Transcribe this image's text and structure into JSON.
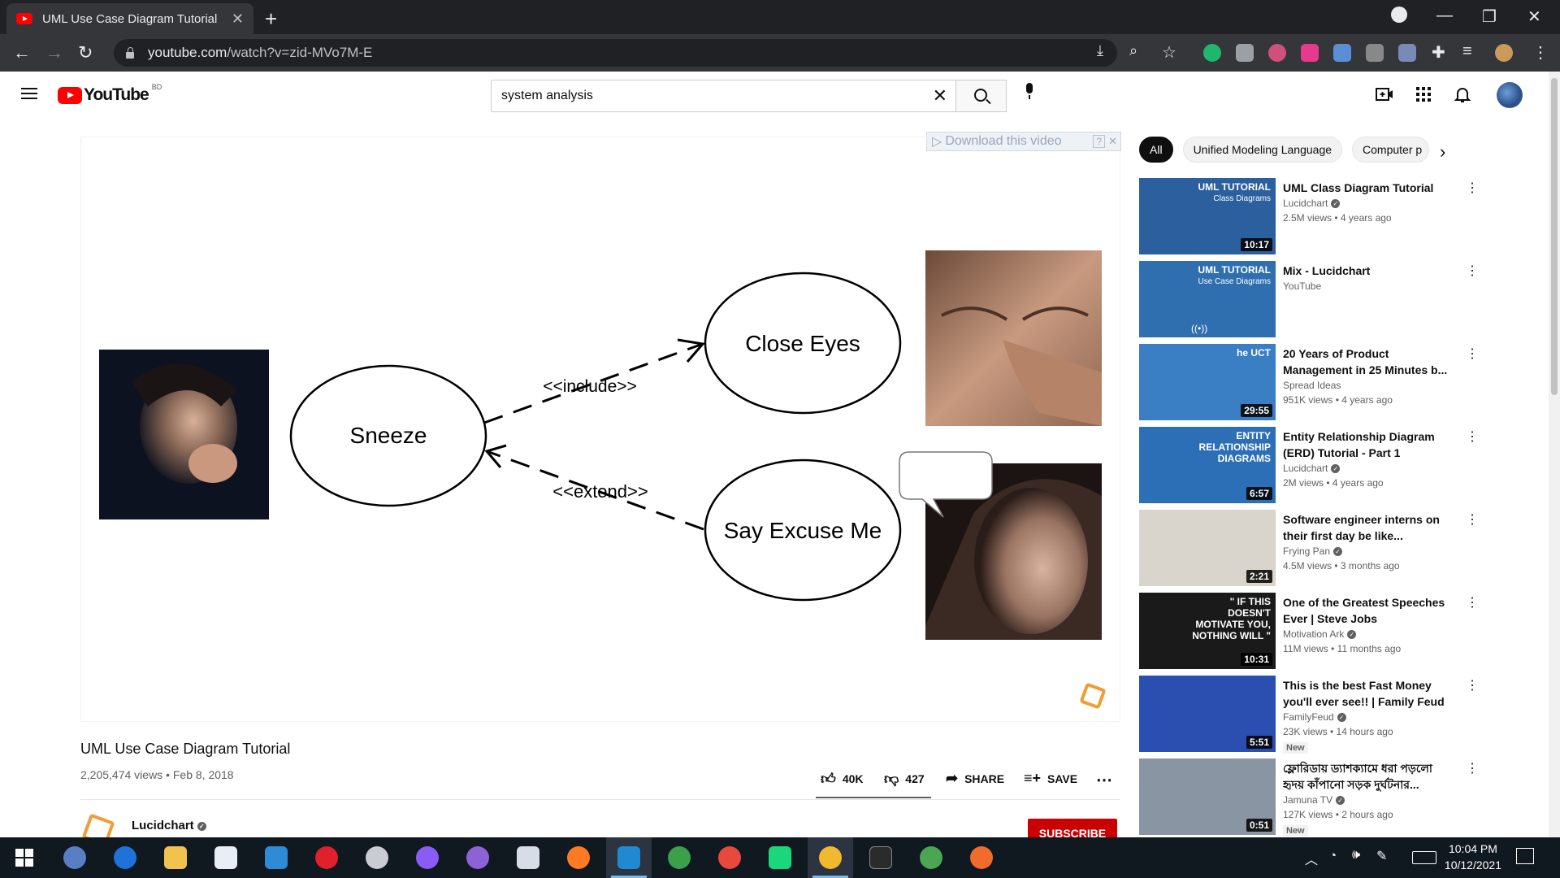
{
  "browser": {
    "tab_title": "UML Use Case Diagram Tutorial",
    "url_host": "youtube.com",
    "url_path": "/watch?v=zid-MVo7M-E"
  },
  "youtube": {
    "logo_text": "YouTube",
    "country_code": "BD",
    "search_value": "system analysis"
  },
  "video": {
    "download_bar_label": "Download this video",
    "download_bar_help": "?",
    "title": "UML Use Case Diagram Tutorial",
    "views_date": "2,205,474 views • Feb 8, 2018",
    "likes": "40K",
    "dislikes": "427",
    "share_label": "SHARE",
    "save_label": "SAVE",
    "channel": "Lucidchart",
    "subscribe_label": "SUBSCRIBE",
    "diagram": {
      "use_case_1": "Sneeze",
      "use_case_2": "Close Eyes",
      "use_case_3": "Say Excuse Me",
      "include_label": "<<include>>",
      "extend_label": "<<extend>>"
    }
  },
  "chips": [
    "All",
    "Unified Modeling Language",
    "Computer p"
  ],
  "recommendations": [
    {
      "title": "UML Class Diagram Tutorial",
      "channel": "Lucidchart",
      "verified": true,
      "meta": "2.5M views • 4 years ago",
      "duration": "10:17",
      "thumb_color": "#2b5f9e",
      "thumb_text": "UML TUTORIAL",
      "thumb_sub": "Class Diagrams"
    },
    {
      "title": "Mix - Lucidchart",
      "channel": "YouTube",
      "verified": false,
      "meta": "",
      "duration": "",
      "thumb_color": "#2f6fb0",
      "thumb_text": "UML TUTORIAL",
      "thumb_sub": "Use Case Diagrams"
    },
    {
      "title": "20 Years of Product Management in 25 Minutes b...",
      "channel": "Spread Ideas",
      "verified": false,
      "meta": "951K views • 4 years ago",
      "duration": "29:55",
      "thumb_color": "#3a7fc4",
      "thumb_text": "he UCT",
      "thumb_sub": ""
    },
    {
      "title": "Entity Relationship Diagram (ERD) Tutorial - Part 1",
      "channel": "Lucidchart",
      "verified": true,
      "meta": "2M views • 4 years ago",
      "duration": "6:57",
      "thumb_color": "#2d6fb7",
      "thumb_text": "ENTITY RELATIONSHIP DIAGRAMS",
      "thumb_sub": ""
    },
    {
      "title": "Software engineer interns on their first day be like...",
      "channel": "Frying Pan",
      "verified": true,
      "meta": "4.5M views • 3 months ago",
      "duration": "2:21",
      "thumb_color": "#d9d4cc",
      "thumb_text": "",
      "thumb_sub": ""
    },
    {
      "title": "One of the Greatest Speeches Ever | Steve Jobs",
      "channel": "Motivation Ark",
      "verified": true,
      "meta": "11M views • 11 months ago",
      "duration": "10:31",
      "thumb_color": "#1a1a1a",
      "thumb_text": "\" IF THIS DOESN'T MOTIVATE YOU, NOTHING WILL \"",
      "thumb_sub": ""
    },
    {
      "title": "This is the best Fast Money you'll ever see!! | Family Feud",
      "channel": "FamilyFeud",
      "verified": true,
      "meta": "23K views • 14 hours ago",
      "duration": "5:51",
      "thumb_color": "#2a4fb0",
      "thumb_text": "",
      "thumb_sub": "",
      "badge": "New"
    },
    {
      "title": "ফ্লোরিডায় ড্যাশক্যামে ধরা পড়লো হৃদয় কাঁপানো সড়ক দুর্ঘটনার...",
      "channel": "Jamuna TV",
      "verified": true,
      "meta": "127K views • 2 hours ago",
      "duration": "0:51",
      "thumb_color": "#8a95a3",
      "thumb_text": "",
      "thumb_sub": "",
      "badge": "New"
    }
  ],
  "taskbar": {
    "time": "10:04 PM",
    "date": "10/12/2021"
  }
}
